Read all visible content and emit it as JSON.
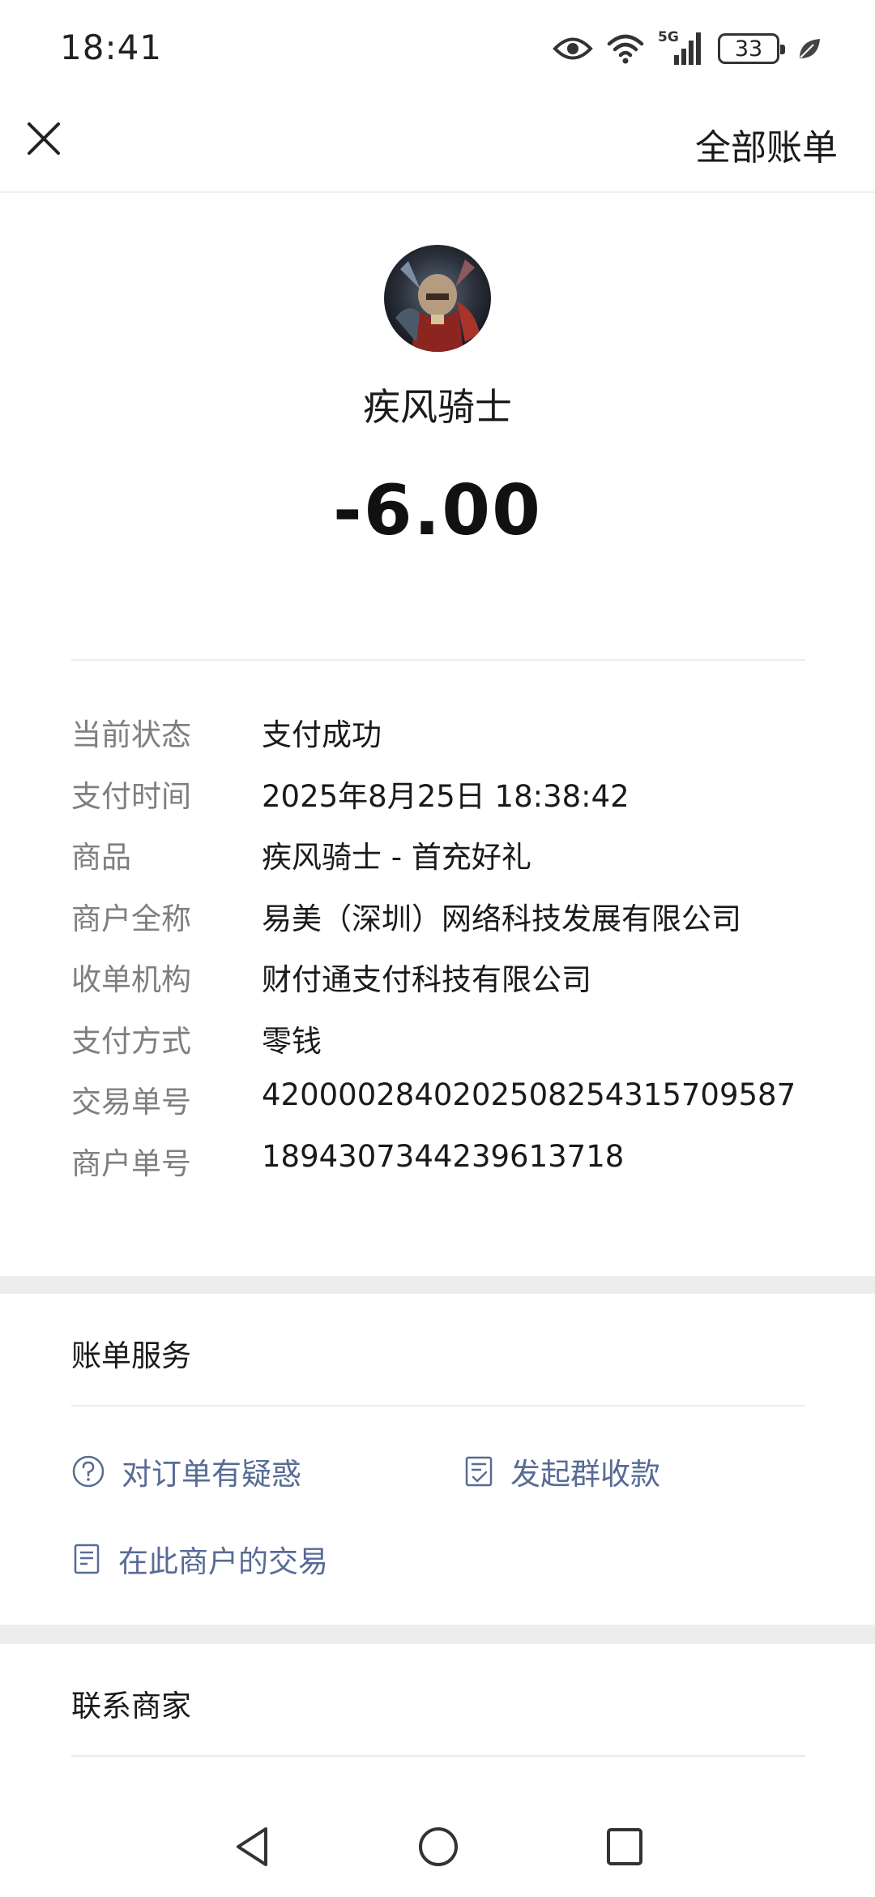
{
  "status_bar": {
    "time": "18:41",
    "network": "5G",
    "battery": "33",
    "icons": [
      "eye-icon",
      "wifi-icon",
      "signal-icon",
      "battery-icon",
      "leaf-icon"
    ]
  },
  "top_bar": {
    "close_icon": "close-icon",
    "all_bills_label": "全部账单"
  },
  "header": {
    "avatar": "merchant-avatar",
    "merchant_name": "疾风骑士",
    "amount": "-6.00"
  },
  "details": [
    {
      "label": "当前状态",
      "value": "支付成功"
    },
    {
      "label": "支付时间",
      "value": "2025年8月25日 18:38:42"
    },
    {
      "label": "商品",
      "value": "疾风骑士 - 首充好礼"
    },
    {
      "label": "商户全称",
      "value": "易美（深圳）网络科技发展有限公司"
    },
    {
      "label": "收单机构",
      "value": "财付通支付科技有限公司"
    },
    {
      "label": "支付方式",
      "value": "零钱"
    },
    {
      "label": "交易单号",
      "value": "4200002840202508254315709587"
    },
    {
      "label": "商户单号",
      "value": "1894307344239613718"
    }
  ],
  "bill_services": {
    "title": "账单服务",
    "items": [
      {
        "label": "对订单有疑惑",
        "icon": "question-circle-icon"
      },
      {
        "label": "发起群收款",
        "icon": "checklist-icon"
      },
      {
        "label": "在此商户的交易",
        "icon": "document-icon"
      }
    ]
  },
  "contact": {
    "title": "联系商家"
  },
  "nav_bar": {
    "icons": [
      "back-triangle-icon",
      "home-circle-icon",
      "recent-square-icon"
    ]
  },
  "colors": {
    "link": "#576b95",
    "label": "#7f7f7f",
    "section_gap": "#ededed"
  }
}
